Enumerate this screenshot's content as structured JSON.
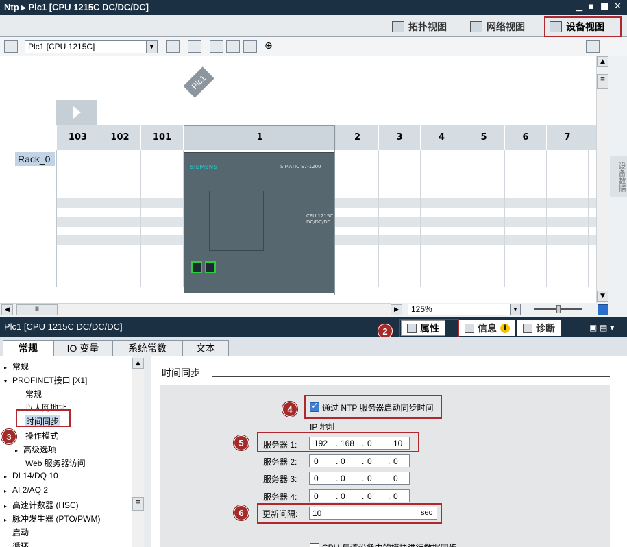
{
  "titlebar": {
    "title": "Ntp ▸ Plc1 [CPU 1215C DC/DC/DC]"
  },
  "views": {
    "topology": "拓扑视图",
    "network": "网络视图",
    "device": "设备视图"
  },
  "toolbar": {
    "device_select": "Plc1 [CPU 1215C]"
  },
  "canvas": {
    "plc_name": "Plc1",
    "rack_name": "Rack_0",
    "slots": [
      "103",
      "102",
      "101",
      "1",
      "2",
      "3",
      "4",
      "5",
      "6",
      "7"
    ],
    "cpu": {
      "brand": "SIEMENS",
      "series": "SIMATIC S7-1200",
      "model_line1": "CPU 1215C",
      "model_line2": "DC/DC/DC"
    },
    "zoom": "125%"
  },
  "side_tab": "设备数据",
  "props": {
    "title": "Plc1 [CPU 1215C DC/DC/DC]",
    "tabs": {
      "properties": "属性",
      "info": "信息",
      "diagnostics": "诊断"
    },
    "subtabs": [
      "常规",
      "IO 变量",
      "系统常数",
      "文本"
    ]
  },
  "tree": {
    "items": [
      {
        "label": "常规",
        "arrow": "▸"
      },
      {
        "label": "PROFINET接口 [X1]",
        "arrow": "▾"
      },
      {
        "label": "常规",
        "arrow": ""
      },
      {
        "label": "以太网地址",
        "arrow": ""
      },
      {
        "label": "时间同步",
        "arrow": ""
      },
      {
        "label": "操作模式",
        "arrow": ""
      },
      {
        "label": "高级选项",
        "arrow": "▸"
      },
      {
        "label": "Web 服务器访问",
        "arrow": ""
      },
      {
        "label": "DI 14/DQ 10",
        "arrow": "▸"
      },
      {
        "label": "AI 2/AQ 2",
        "arrow": "▸"
      },
      {
        "label": "高速计数器 (HSC)",
        "arrow": "▸"
      },
      {
        "label": "脉冲发生器 (PTO/PWM)",
        "arrow": "▸"
      },
      {
        "label": "启动",
        "arrow": ""
      },
      {
        "label": "循环",
        "arrow": ""
      }
    ]
  },
  "timesync": {
    "section_title": "时间同步",
    "ntp_checkbox_label": "通过 NTP 服务器启动同步时间",
    "ntp_checked": true,
    "ip_header": "IP 地址",
    "servers": [
      {
        "label": "服务器 1:",
        "octets": [
          "192",
          "168",
          "0",
          "10"
        ]
      },
      {
        "label": "服务器 2:",
        "octets": [
          "0",
          "0",
          "0",
          "0"
        ]
      },
      {
        "label": "服务器 3:",
        "octets": [
          "0",
          "0",
          "0",
          "0"
        ]
      },
      {
        "label": "服务器 4:",
        "octets": [
          "0",
          "0",
          "0",
          "0"
        ]
      }
    ],
    "interval_label": "更新间隔:",
    "interval_value": "10",
    "interval_unit": "sec",
    "cpu_sync_label": "CPU 与该设备中的模块进行数据同步"
  },
  "badges": [
    "1",
    "2",
    "3",
    "4",
    "5",
    "6"
  ],
  "colors": {
    "title_bg": "#1c3043",
    "highlight": "#b0282d",
    "badge": "#a52a2a"
  }
}
